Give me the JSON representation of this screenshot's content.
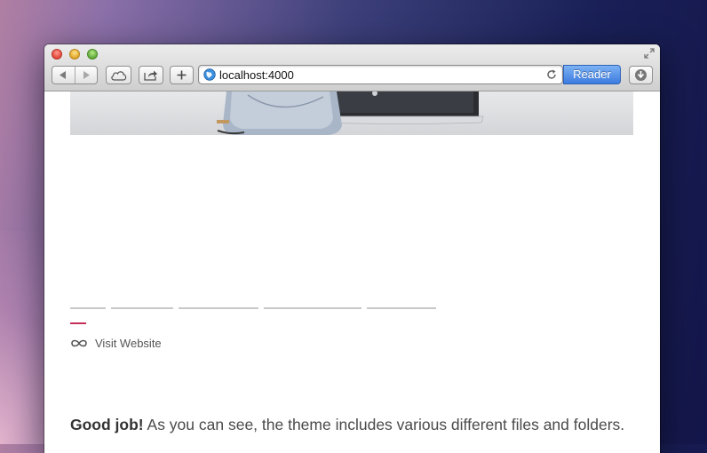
{
  "browser": {
    "address": "localhost:4000",
    "reader_label": "Reader",
    "colors": {
      "reader_blue": "#3d7be0",
      "accent": "#c4305a"
    },
    "icons": [
      "back-icon",
      "forward-icon",
      "icloud-icon",
      "share-icon",
      "add-icon",
      "globe-icon",
      "reload-icon",
      "downloads-icon",
      "fullscreen-icon"
    ]
  },
  "page": {
    "visit_label": "Visit Website",
    "good_job_bold": "Good job!",
    "good_job_text": " As you can see, the theme includes various different files and folders."
  }
}
